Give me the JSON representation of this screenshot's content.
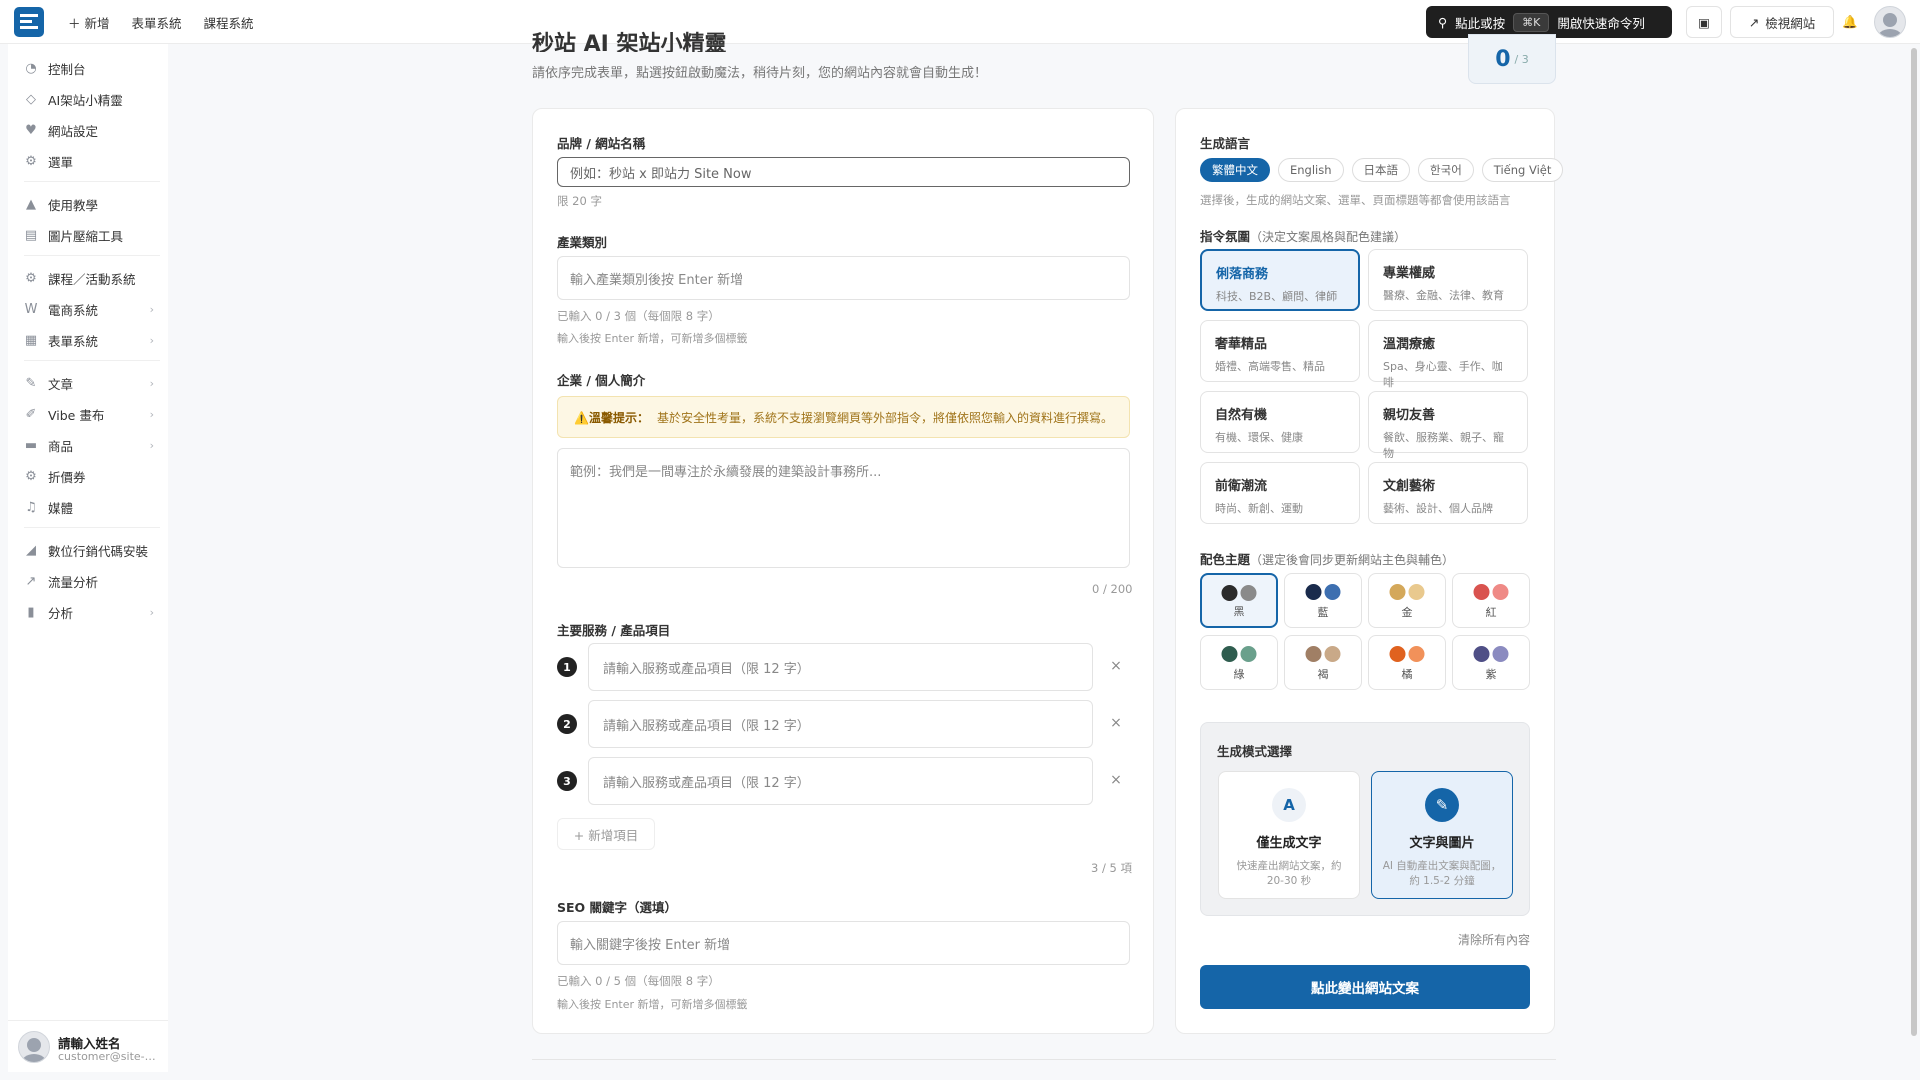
{
  "topbar": {
    "new_label": "新增",
    "nav": [
      "表單系統",
      "課程系統"
    ],
    "command": {
      "label": "點此或按",
      "shortcut": "⌘K",
      "action": "開啟快速命令列"
    },
    "preview_label": "檢視網站"
  },
  "sidebar": {
    "items": [
      {
        "label": "控制台",
        "icon": "dashboard-icon"
      },
      {
        "label": "AI架站小精靈",
        "icon": "diamond-icon"
      },
      {
        "label": "網站設定",
        "icon": "heart-icon"
      },
      {
        "label": "選單",
        "icon": "gear-icon"
      },
      {
        "label": "使用教學",
        "icon": "graduation-icon"
      },
      {
        "label": "圖片壓縮工具",
        "icon": "image-icon"
      },
      {
        "label": "課程／活動系統",
        "icon": "gear-icon"
      },
      {
        "label": "電商系統",
        "icon": "woo-icon"
      },
      {
        "label": "表單系統",
        "icon": "form-icon"
      },
      {
        "label": "文章",
        "icon": "pin-icon"
      },
      {
        "label": "Vibe 畫布",
        "icon": "brush-icon"
      },
      {
        "label": "商品",
        "icon": "box-icon"
      },
      {
        "label": "折價券",
        "icon": "gear-icon"
      },
      {
        "label": "媒體",
        "icon": "media-icon"
      },
      {
        "label": "數位行銷代碼安裝",
        "icon": "chart-icon"
      },
      {
        "label": "流量分析",
        "icon": "trend-icon"
      },
      {
        "label": "分析",
        "icon": "bar-icon"
      }
    ],
    "user": {
      "name": "請輸入姓名",
      "email": "customer@site-now.com"
    }
  },
  "page": {
    "title": "秒站 AI 架站小精靈",
    "subtitle": "請依序完成表單，點選按鈕啟動魔法，稍待片刻，您的網站內容就會自動生成！",
    "counter": {
      "value": "0",
      "total": "/ 3"
    }
  },
  "form": {
    "brand": {
      "label": "品牌 / 網站名稱",
      "placeholder": "例如：秒站 x 即站力 Site Now",
      "hint": "限 20 字"
    },
    "industry": {
      "label": "產業類別",
      "placeholder": "輸入產業類別後按 Enter 新增",
      "hint1": "已輸入 0 / 3 個（每個限 8 字）",
      "hint2": "輸入後按 Enter 新增，可新增多個標籤"
    },
    "intro": {
      "label": "企業 / 個人簡介",
      "warn_title": "⚠️溫馨提示：",
      "warn_text": "基於安全性考量，系統不支援瀏覽網頁等外部指令，將僅依照您輸入的資料進行撰寫。",
      "placeholder": "範例：我們是一間專注於永續發展的建築設計事務所...",
      "count": "0 / 200"
    },
    "services": {
      "label": "主要服務 / 產品項目",
      "items": [
        {
          "n": "1",
          "placeholder": "請輸入服務或產品項目（限 12 字）"
        },
        {
          "n": "2",
          "placeholder": "請輸入服務或產品項目（限 12 字）"
        },
        {
          "n": "3",
          "placeholder": "請輸入服務或產品項目（限 12 字）"
        }
      ],
      "add_label": "+ 新增項目",
      "count": "3 / 5 項"
    },
    "seo": {
      "label": "SEO 關鍵字（選填）",
      "placeholder": "輸入關鍵字後按 Enter 新增",
      "hint1": "已輸入 0 / 5 個（每個限 8 字）",
      "hint2": "輸入後按 Enter 新增，可新增多個標籤"
    }
  },
  "settings": {
    "lang_label": "生成語言",
    "languages": [
      "繁體中文",
      "English",
      "日本語",
      "한국어",
      "Tiếng Việt"
    ],
    "lang_hint": "選擇後，生成的網站文案、選單、頁面標題等都會使用該語言",
    "mood_label": "指令氛圍",
    "mood_note": "（決定文案風格與配色建議）",
    "moods": [
      {
        "title": "俐落商務",
        "desc": "科技、B2B、顧問、律師"
      },
      {
        "title": "專業權威",
        "desc": "醫療、金融、法律、教育"
      },
      {
        "title": "奢華精品",
        "desc": "婚禮、高端零售、精品"
      },
      {
        "title": "溫潤療癒",
        "desc": "Spa、身心靈、手作、咖啡"
      },
      {
        "title": "自然有機",
        "desc": "有機、環保、健康"
      },
      {
        "title": "親切友善",
        "desc": "餐飲、服務業、親子、寵物"
      },
      {
        "title": "前衛潮流",
        "desc": "時尚、新創、運動"
      },
      {
        "title": "文創藝術",
        "desc": "藝術、設計、個人品牌"
      }
    ],
    "theme_label": "配色主題",
    "theme_note": "（選定後會同步更新網站主色與輔色）",
    "themes": [
      {
        "name": "黑",
        "c1": "#2b2b2b",
        "c2": "#8a8a8a"
      },
      {
        "name": "藍",
        "c1": "#1a2b4c",
        "c2": "#3d6fb0"
      },
      {
        "name": "金",
        "c1": "#d4a85a",
        "c2": "#e9c98e"
      },
      {
        "name": "紅",
        "c1": "#d9534f",
        "c2": "#ef8a86"
      },
      {
        "name": "綠",
        "c1": "#2f5d4f",
        "c2": "#6aa08c"
      },
      {
        "name": "褐",
        "c1": "#a07f65",
        "c2": "#c9a988"
      },
      {
        "name": "橘",
        "c1": "#e0621f",
        "c2": "#f1915a"
      },
      {
        "name": "紫",
        "c1": "#4f4f86",
        "c2": "#8b8bc0"
      }
    ],
    "mode_label": "生成模式選擇",
    "modes": [
      {
        "icon": "A",
        "title": "僅生成文字",
        "desc": "快速產出網站文案，約 20-30 秒"
      },
      {
        "icon": "✎",
        "title": "文字與圖片",
        "desc": "AI 自動產出文案與配圖，約 1.5-2 分鐘"
      }
    ],
    "clear_label": "清除所有內容",
    "go_label": "點此變出網站文案"
  },
  "colors": {
    "primary": "#1565a8"
  }
}
